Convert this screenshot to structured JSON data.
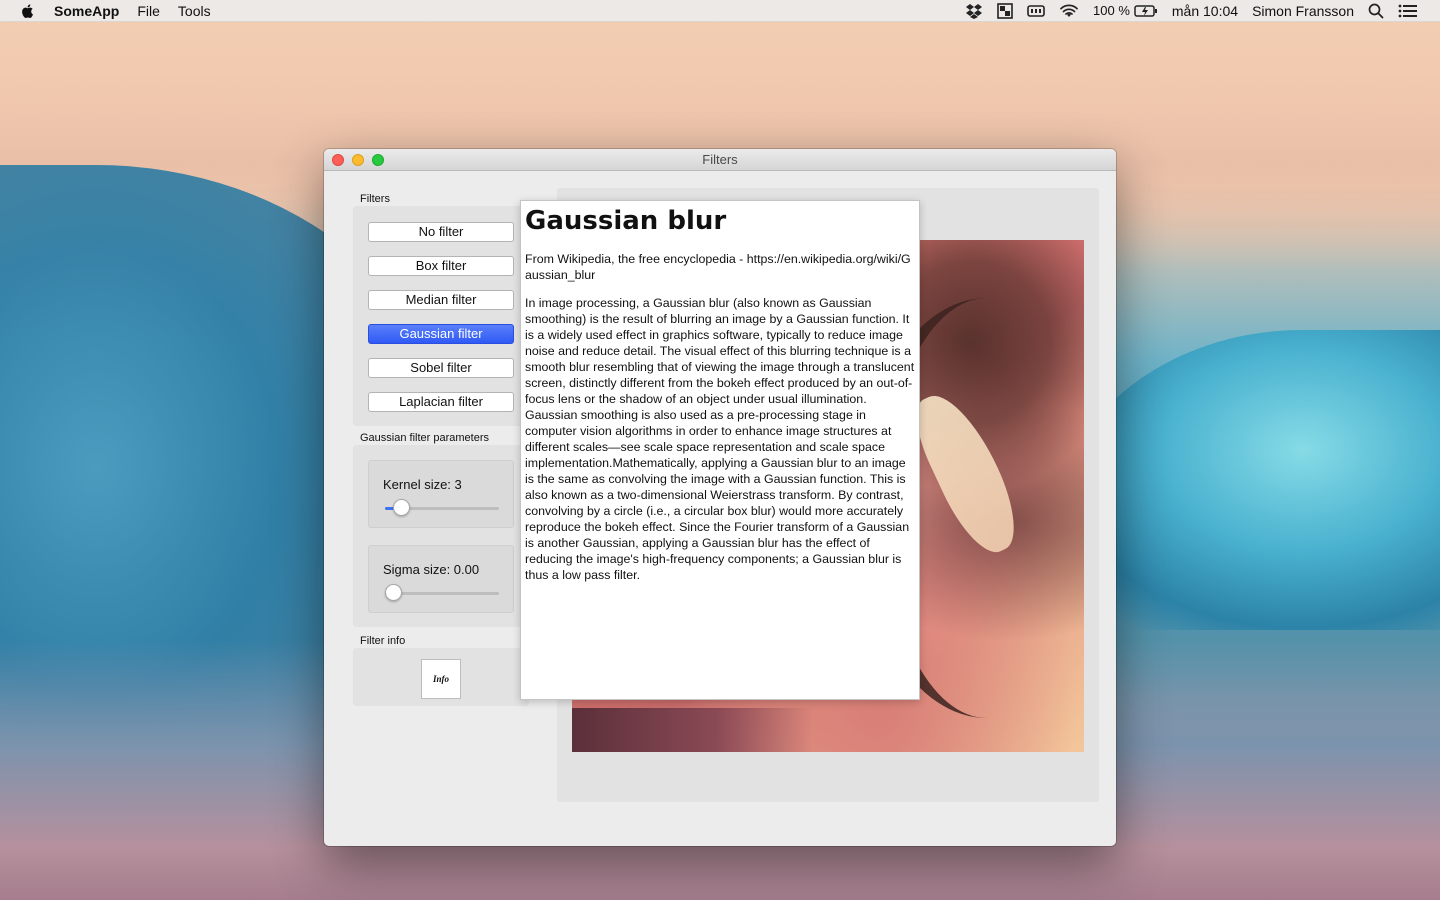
{
  "menubar": {
    "app_name": "SomeApp",
    "menus": [
      "File",
      "Tools"
    ],
    "battery_text": "100 %",
    "clock": "mån 10:04",
    "user": "Simon Fransson"
  },
  "window": {
    "title": "Filters",
    "filters_section_label": "Filters",
    "filters": [
      {
        "label": "No filter"
      },
      {
        "label": "Box filter"
      },
      {
        "label": "Median filter"
      },
      {
        "label": "Gaussian filter"
      },
      {
        "label": "Sobel filter"
      },
      {
        "label": "Laplacian filter"
      }
    ],
    "active_filter": "Gaussian filter",
    "params_section_label": "Gaussian filter parameters",
    "kernel_label": "Kernel size: 3",
    "kernel_slider_fraction": 0.08,
    "sigma_label": "Sigma size: 0.00",
    "sigma_slider_fraction": 0.0,
    "info_section_label": "Filter info",
    "info_button_label": "Info"
  },
  "popup": {
    "title": "Gaussian blur",
    "source": "From Wikipedia, the free encyclopedia - https://en.wikipedia.org/wiki/Gaussian_blur",
    "body": "In image processing, a Gaussian blur (also known as Gaussian smoothing) is the result of blurring an image by a Gaussian function. It is a widely used effect in graphics software, typically to reduce image noise and reduce detail. The visual effect of this blurring technique is a smooth blur resembling that of viewing the image through a translucent screen, distinctly different from the bokeh effect produced by an out-of-focus lens or the shadow of an object under usual illumination. Gaussian smoothing is also used as a pre-processing stage in computer vision algorithms in order to enhance image structures at different scales—see scale space representation and scale space implementation.Mathematically, applying a Gaussian blur to an image is the same as convolving the image with a Gaussian function. This is also known as a two-dimensional Weierstrass transform. By contrast, convolving by a circle (i.e., a circular box blur) would more accurately reproduce the bokeh effect. Since the Fourier transform of a Gaussian is another Gaussian, applying a Gaussian blur has the effect of reducing the image's high-frequency components; a Gaussian blur is thus a low pass filter."
  },
  "colors": {
    "active_button": "#2f5af5",
    "close": "#fc5f57",
    "minimize": "#fdbc2e",
    "maximize": "#28c840"
  }
}
